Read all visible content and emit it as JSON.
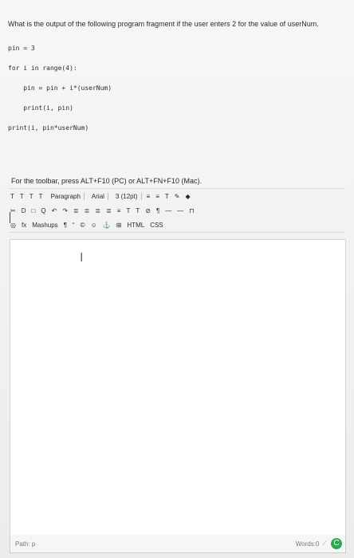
{
  "question": "What is the output of the following program fragment if the user enters 2 for the value of userNum.",
  "code": [
    "pin = 3",
    "for i in range(4):",
    "    pin = pin + i*(userNum)",
    "    print(i, pin)",
    "print(i, pin*userNum)"
  ],
  "toolbar_hint": "For the toolbar, press ALT+F10 (PC) or ALT+FN+F10 (Mac).",
  "toolbar": {
    "row1": [
      "T",
      "T",
      "T",
      "T",
      "Paragraph",
      "Arial",
      "3 (12pt)",
      "≡",
      "≡",
      "T",
      "✎",
      "◆"
    ],
    "row2": [
      "✂",
      "D",
      "□",
      "Q",
      "↶",
      "↷",
      "≣",
      "≣",
      "≣",
      "≣",
      "≡",
      "T",
      "T",
      "⊘",
      "¶",
      "—",
      "—",
      "⊓"
    ],
    "row3": [
      "◎",
      "fx",
      "Mashups",
      "¶",
      "“",
      "©",
      "☺",
      "⚓",
      "⊞",
      "HTML",
      "CSS"
    ]
  },
  "status": {
    "path": "Path: p",
    "words": "Words:0"
  }
}
